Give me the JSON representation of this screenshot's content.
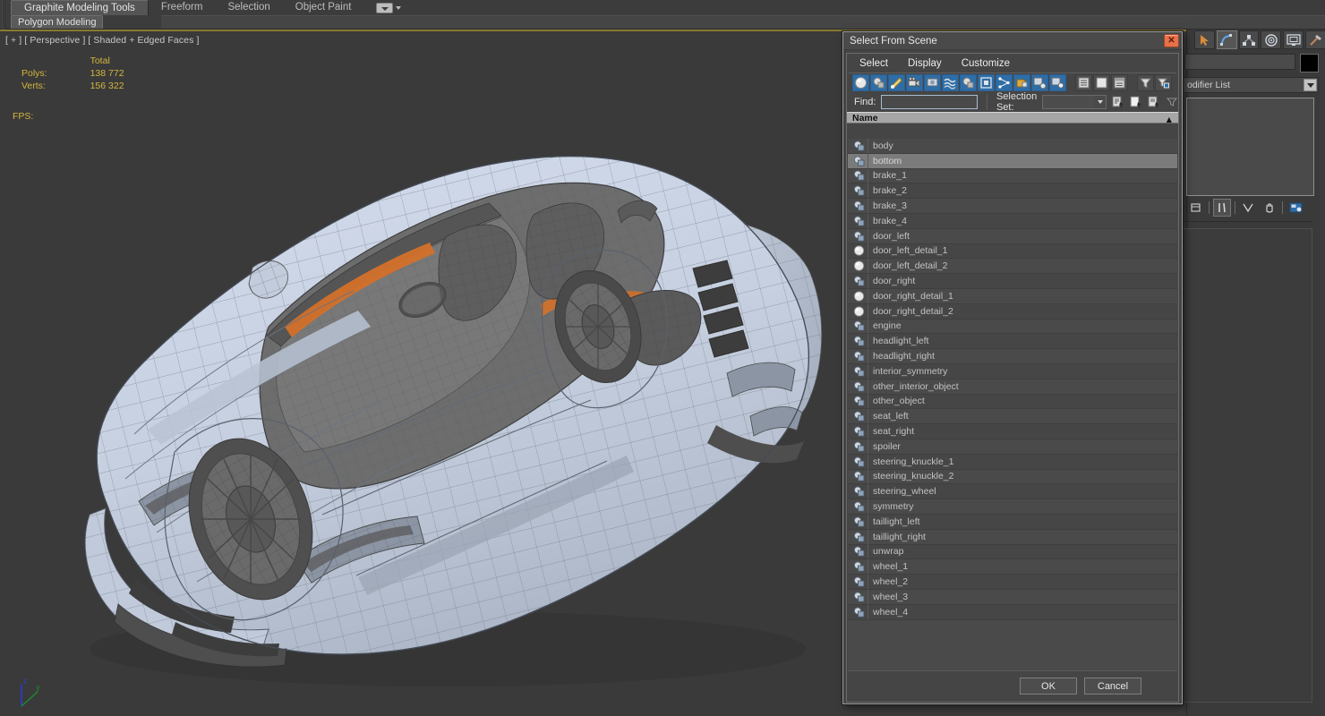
{
  "ribbon": {
    "tabs": [
      {
        "label": "Graphite Modeling Tools",
        "active": true
      },
      {
        "label": "Freeform",
        "active": false
      },
      {
        "label": "Selection",
        "active": false
      },
      {
        "label": "Object Paint",
        "active": false
      }
    ],
    "subtab": "Polygon Modeling",
    "dropdown_icon": "viewport-dropdown-icon"
  },
  "viewport": {
    "label": "[ + ] [ Perspective ] [ Shaded + Edged Faces ]",
    "stats": {
      "header": "Total",
      "polys_label": "Polys:",
      "polys_value": "138 772",
      "verts_label": "Verts:",
      "verts_value": "156 322",
      "fps_label": "FPS:"
    },
    "axis": {
      "z": "z",
      "y": "y"
    },
    "colors": {
      "background": "#3a3a3a",
      "stats_text": "#d4b63c",
      "body_fill": "#c9d3e0",
      "interior_fill": "#6f6f6f",
      "accent_orange": "#d4712a",
      "wire": "#4a4a4a"
    }
  },
  "command_panel": {
    "tabs": [
      {
        "name": "create-tab",
        "icon": "arrow-cursor-icon"
      },
      {
        "name": "modify-tab",
        "icon": "bent-arc-icon"
      },
      {
        "name": "hierarchy-tab",
        "icon": "hierarchy-icon"
      },
      {
        "name": "motion-tab",
        "icon": "wheel-icon"
      },
      {
        "name": "display-tab",
        "icon": "monitor-icon"
      },
      {
        "name": "utilities-tab",
        "icon": "hammer-icon"
      }
    ],
    "modifier_list_label": "odifier List",
    "object_color": "#000000"
  },
  "dialog": {
    "title": "Select From Scene",
    "close_icon": "close-icon",
    "menu": [
      "Select",
      "Display",
      "Customize"
    ],
    "toolbar": [
      {
        "name": "display-geometry-button",
        "icon": "sphere-icon",
        "active": true
      },
      {
        "name": "display-shapes-button",
        "icon": "shapes-icon",
        "active": true
      },
      {
        "name": "display-lights-button",
        "icon": "light-icon",
        "active": true
      },
      {
        "name": "display-cameras-button",
        "icon": "camera-icon",
        "active": true
      },
      {
        "name": "display-helpers-button",
        "icon": "helper-icon",
        "active": true
      },
      {
        "name": "display-space-warps-button",
        "icon": "wave-icon",
        "active": true
      },
      {
        "name": "display-groups-button",
        "icon": "group-icon",
        "active": true
      },
      {
        "name": "display-xrefs-button",
        "icon": "xref-icon",
        "active": true
      },
      {
        "name": "display-bones-button",
        "icon": "bone-icon",
        "active": true
      },
      {
        "name": "display-containers-button",
        "icon": "container-icon",
        "active": true
      },
      {
        "name": "display-children-button",
        "icon": "children-icon",
        "active": true
      },
      {
        "name": "display-influences-button",
        "icon": "influences-icon",
        "active": true
      },
      {
        "name": "list-view-button",
        "icon": "list-lines-icon",
        "active": false
      },
      {
        "name": "detail-view-button",
        "icon": "blank-page-icon",
        "active": false
      },
      {
        "name": "columns-view-button",
        "icon": "columns-icon",
        "active": false
      },
      {
        "name": "filter-button",
        "icon": "funnel-icon",
        "active": false
      },
      {
        "name": "advanced-filter-button",
        "icon": "funnel-settings-icon",
        "active": false
      }
    ],
    "find": {
      "label": "Find:",
      "value": "",
      "placeholder": ""
    },
    "selection_set": {
      "label": "Selection Set:",
      "value": "",
      "options": []
    },
    "selection_set_buttons": [
      {
        "name": "select-by-name-button",
        "icon": "page-select-icon"
      },
      {
        "name": "select-none-button",
        "icon": "page-cursor-icon"
      },
      {
        "name": "select-invert-button",
        "icon": "page-invert-icon"
      },
      {
        "name": "filter-dropdown-button",
        "icon": "funnel-small-icon"
      }
    ],
    "column_header": "Name",
    "sort_indicator": "sort-ascending-icon",
    "rows": [
      {
        "name": "body",
        "icon": "mesh-icon",
        "selected": false
      },
      {
        "name": "bottom",
        "icon": "mesh-icon",
        "selected": true
      },
      {
        "name": "brake_1",
        "icon": "mesh-icon",
        "selected": false
      },
      {
        "name": "brake_2",
        "icon": "mesh-icon",
        "selected": false
      },
      {
        "name": "brake_3",
        "icon": "mesh-icon",
        "selected": false
      },
      {
        "name": "brake_4",
        "icon": "mesh-icon",
        "selected": false
      },
      {
        "name": "door_left",
        "icon": "mesh-icon",
        "selected": false
      },
      {
        "name": "door_left_detail_1",
        "icon": "sphere-icon",
        "selected": false
      },
      {
        "name": "door_left_detail_2",
        "icon": "sphere-icon",
        "selected": false
      },
      {
        "name": "door_right",
        "icon": "mesh-icon",
        "selected": false
      },
      {
        "name": "door_right_detail_1",
        "icon": "sphere-icon",
        "selected": false
      },
      {
        "name": "door_right_detail_2",
        "icon": "sphere-icon",
        "selected": false
      },
      {
        "name": "engine",
        "icon": "mesh-icon",
        "selected": false
      },
      {
        "name": "headlight_left",
        "icon": "mesh-icon",
        "selected": false
      },
      {
        "name": "headlight_right",
        "icon": "mesh-icon",
        "selected": false
      },
      {
        "name": "interior_symmetry",
        "icon": "mesh-icon",
        "selected": false
      },
      {
        "name": "other_interior_object",
        "icon": "mesh-icon",
        "selected": false
      },
      {
        "name": "other_object",
        "icon": "mesh-icon",
        "selected": false
      },
      {
        "name": "seat_left",
        "icon": "mesh-icon",
        "selected": false
      },
      {
        "name": "seat_right",
        "icon": "mesh-icon",
        "selected": false
      },
      {
        "name": "spoiler",
        "icon": "mesh-icon",
        "selected": false
      },
      {
        "name": "steering_knuckle_1",
        "icon": "mesh-icon",
        "selected": false
      },
      {
        "name": "steering_knuckle_2",
        "icon": "mesh-icon",
        "selected": false
      },
      {
        "name": "steering_wheel",
        "icon": "mesh-icon",
        "selected": false
      },
      {
        "name": "symmetry",
        "icon": "mesh-icon",
        "selected": false
      },
      {
        "name": "taillight_left",
        "icon": "mesh-icon",
        "selected": false
      },
      {
        "name": "taillight_right",
        "icon": "mesh-icon",
        "selected": false
      },
      {
        "name": "unwrap",
        "icon": "mesh-icon",
        "selected": false
      },
      {
        "name": "wheel_1",
        "icon": "mesh-icon",
        "selected": false
      },
      {
        "name": "wheel_2",
        "icon": "mesh-icon",
        "selected": false
      },
      {
        "name": "wheel_3",
        "icon": "mesh-icon",
        "selected": false
      },
      {
        "name": "wheel_4",
        "icon": "mesh-icon",
        "selected": false
      }
    ],
    "ok_label": "OK",
    "cancel_label": "Cancel"
  }
}
